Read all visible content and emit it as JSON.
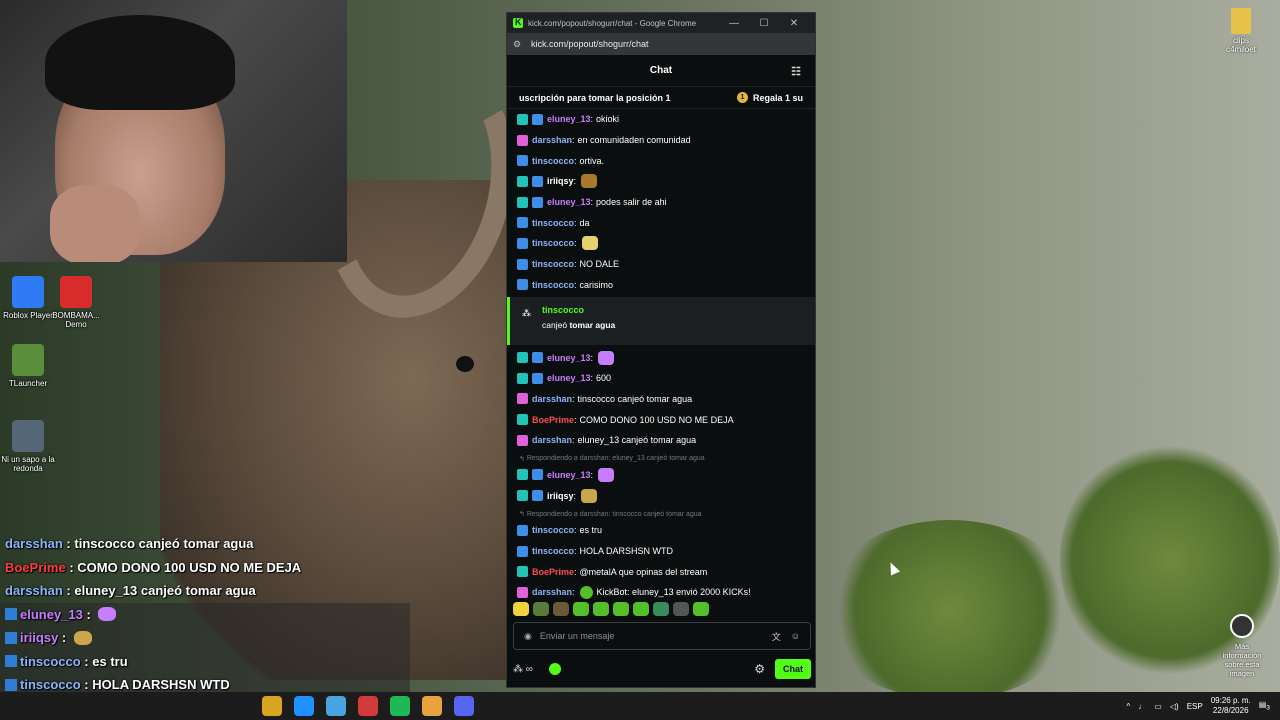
{
  "desktop": {
    "icons": [
      {
        "label": "Roblox Player",
        "color": "#2f7af5"
      },
      {
        "label": "BOMBAMA... Demo",
        "color": "#d82b2b"
      },
      {
        "label": "TLauncher",
        "color": "#5b8e3a"
      },
      {
        "label": "Ni un sapo a la redonda",
        "color": "#556677"
      }
    ],
    "folder_label": "clips c4miloet",
    "info_widget": "Más información sobre esta imagen"
  },
  "overlay_chat": [
    {
      "user": "darsshan",
      "user_color": "#8ab4f8",
      "sep": " : ",
      "text": "tinscocco canjeó tomar agua",
      "badge": false,
      "emote": ""
    },
    {
      "user": "BoePrime",
      "user_color": "#ff3b3b",
      "sep": " : ",
      "text": "COMO DONO 100 USD NO ME DEJA",
      "badge": false,
      "emote": ""
    },
    {
      "user": "darsshan",
      "user_color": "#8ab4f8",
      "sep": " : ",
      "text": "eluney_13 canjeó tomar agua",
      "badge": false,
      "emote": ""
    },
    {
      "user": "eluney_13",
      "user_color": "#c77dff",
      "sep": " : ",
      "text": "",
      "badge": true,
      "emote": "#c77dff"
    },
    {
      "user": "iriiqsy",
      "user_color": "#c77dff",
      "sep": " : ",
      "text": "",
      "badge": true,
      "emote": "#c9a74a"
    },
    {
      "user": "tinscocco",
      "user_color": "#8ab4f8",
      "sep": " : ",
      "text": "es tru",
      "badge": true,
      "emote": ""
    },
    {
      "user": "tinscocco",
      "user_color": "#8ab4f8",
      "sep": " : ",
      "text": "HOLA DARSHSN WTD",
      "badge": true,
      "emote": ""
    },
    {
      "user": "BoePrime",
      "user_color": "#ff3b3b",
      "sep": " : ",
      "text": "@metalA  que opinas del stream",
      "badge": false,
      "emote": ""
    }
  ],
  "browser": {
    "title": "kick.com/popout/shogurr/chat - Google Chrome",
    "url": "kick.com/popout/shogurr/chat",
    "minimize": "—",
    "maximize": "☐",
    "close": "✕"
  },
  "chat": {
    "header": "Chat",
    "pinned_text": "uscripción para tomar la posición 1",
    "pinned_gift": "Regala 1 su",
    "messages_top": [
      {
        "badges": [
          "sub",
          "og"
        ],
        "user": "eluney_13",
        "color": "#c77dff",
        "text": "okioki",
        "emote": ""
      },
      {
        "badges": [
          "vip"
        ],
        "user": "darsshan",
        "color": "#8ab4f8",
        "text": "en comunidaden comunidad",
        "emote": ""
      },
      {
        "badges": [
          "og"
        ],
        "user": "tinscocco",
        "color": "#8ab4f8",
        "text": "ortiva.",
        "emote": ""
      },
      {
        "badges": [
          "sub",
          "og"
        ],
        "user": "iriiqsy",
        "color": "#ffffff",
        "text": "",
        "emote": "#a77b2a"
      },
      {
        "badges": [
          "sub",
          "og"
        ],
        "user": "eluney_13",
        "color": "#c77dff",
        "text": "podes salir de ahi",
        "emote": ""
      },
      {
        "badges": [
          "og"
        ],
        "user": "tinscocco",
        "color": "#8ab4f8",
        "text": "da",
        "emote": ""
      },
      {
        "badges": [
          "og"
        ],
        "user": "tinscocco",
        "color": "#8ab4f8",
        "text": "",
        "emote": "#e3d36a"
      },
      {
        "badges": [
          "og"
        ],
        "user": "tinscocco",
        "color": "#8ab4f8",
        "text": "NO DALE",
        "emote": ""
      },
      {
        "badges": [
          "og"
        ],
        "user": "tinscocco",
        "color": "#8ab4f8",
        "text": "carisimo",
        "emote": ""
      }
    ],
    "redemption": {
      "user": "tinscocco",
      "action": "canjeó",
      "reward": "tomar agua"
    },
    "messages_mid": [
      {
        "badges": [
          "sub",
          "og"
        ],
        "user": "eluney_13",
        "color": "#c77dff",
        "text": "",
        "emote": "#c77dff"
      },
      {
        "badges": [
          "sub",
          "og"
        ],
        "user": "eluney_13",
        "color": "#c77dff",
        "text": "600",
        "emote": ""
      },
      {
        "badges": [
          "vip"
        ],
        "user": "darsshan",
        "color": "#8ab4f8",
        "text": "tinscocco canjeó tomar agua",
        "emote": ""
      },
      {
        "badges": [
          "bot"
        ],
        "user": "BoePrime",
        "color": "#ff4d4d",
        "text": "COMO DONO 100 USD NO ME DEJA",
        "emote": ""
      },
      {
        "badges": [
          "vip"
        ],
        "user": "darsshan",
        "color": "#8ab4f8",
        "text": "eluney_13 canjeó tomar agua",
        "emote": ""
      }
    ],
    "reply_1": "Respondiendo a darsshan: eluney_13 canjeó tomar agua",
    "messages_reply1": [
      {
        "badges": [
          "sub",
          "og"
        ],
        "user": "eluney_13",
        "color": "#c77dff",
        "text": "",
        "emote": "#c77dff"
      },
      {
        "badges": [
          "sub",
          "og"
        ],
        "user": "iriiqsy",
        "color": "#ffffff",
        "text": "",
        "emote": "#c9a74a"
      }
    ],
    "reply_2": "Respondiendo a darsshan: tinscocco canjeó tomar agua",
    "messages_bottom": [
      {
        "badges": [
          "og"
        ],
        "user": "tinscocco",
        "color": "#8ab4f8",
        "text": "es tru",
        "emote": ""
      },
      {
        "badges": [
          "og"
        ],
        "user": "tinscocco",
        "color": "#8ab4f8",
        "text": "HOLA DARSHSN WTD",
        "emote": ""
      },
      {
        "badges": [
          "bot"
        ],
        "user": "BoePrime",
        "color": "#ff4d4d",
        "text": "@metalA que opinas del stream",
        "emote": ""
      },
      {
        "badges": [
          "vip"
        ],
        "user": "darsshan",
        "color": "#8ab4f8",
        "text": "KickBot: eluney_13 envió 2000 KICKs!",
        "emote": "#53c02a"
      }
    ],
    "emote_bar": [
      "#f0d23a",
      "#5a7a3a",
      "#6b5a3a",
      "#53c02a",
      "#53c02a",
      "#53c02a",
      "#53c02a",
      "#3a8a5a",
      "#555555",
      "#53c02a"
    ],
    "input_placeholder": "Enviar un mensaje",
    "send_label": "Chat"
  },
  "taskbar": {
    "apps": [
      "#d9a520",
      "#1e90ff",
      "#4aa3df",
      "#d13b3b",
      "#1db954",
      "#e8a33d",
      "#5865f2"
    ],
    "language": "ESP",
    "time": "09:26 p. m.",
    "date": "22/8/2026",
    "notifications": "3"
  }
}
